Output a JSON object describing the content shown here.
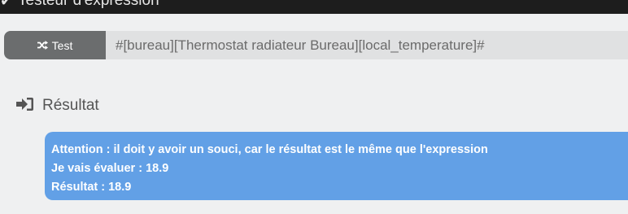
{
  "window": {
    "title": "Testeur d'expression",
    "title_icon": "check-icon"
  },
  "test_bar": {
    "button_label": "Test",
    "button_icon": "shuffle-icon",
    "expression_value": "#[bureau][Thermostat radiateur Bureau][local_temperature]#"
  },
  "result": {
    "heading": "Résultat",
    "heading_icon": "sign-in-icon",
    "warning": "Attention : il doit y avoir un souci, car le résultat est le même que l'expression",
    "evaluate_label": "Je vais évaluer :",
    "evaluate_value": "18.9",
    "result_label": "Résultat :",
    "result_value": "18.9",
    "box_color": "#62a0e6"
  }
}
